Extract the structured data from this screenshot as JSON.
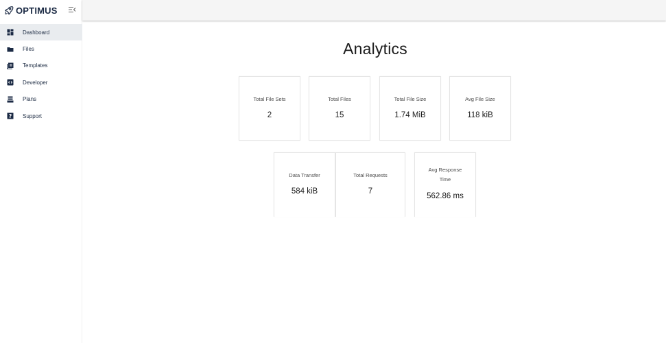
{
  "brand": {
    "name": "OPTIMUS",
    "logo_icon": "rocket-icon",
    "collapse_icon": "menu-collapse-icon",
    "color": "#1b2a44"
  },
  "sidebar": {
    "items": [
      {
        "label": "Dashboard",
        "icon": "dashboard-icon",
        "active": true
      },
      {
        "label": "Files",
        "icon": "folder-icon",
        "active": false
      },
      {
        "label": "Templates",
        "icon": "template-icon",
        "active": false
      },
      {
        "label": "Developer",
        "icon": "code-icon",
        "active": false
      },
      {
        "label": "Plans",
        "icon": "plans-icon",
        "active": false
      },
      {
        "label": "Support",
        "icon": "help-icon",
        "active": false
      }
    ],
    "active_bg": "#e9ecef"
  },
  "main": {
    "title": "Analytics",
    "stats_row1": [
      {
        "label": "Total File Sets",
        "value": "2"
      },
      {
        "label": "Total Files",
        "value": "15"
      },
      {
        "label": "Total File Size",
        "value": "1.74 MiB"
      },
      {
        "label": "Avg File Size",
        "value": "118 kiB"
      }
    ],
    "stats_row2": [
      {
        "label": "Data Transfer",
        "value": "584 kiB"
      },
      {
        "label": "Total Requests",
        "value": "7"
      },
      {
        "label": "Avg Response Time",
        "value": "562.86 ms"
      }
    ]
  }
}
